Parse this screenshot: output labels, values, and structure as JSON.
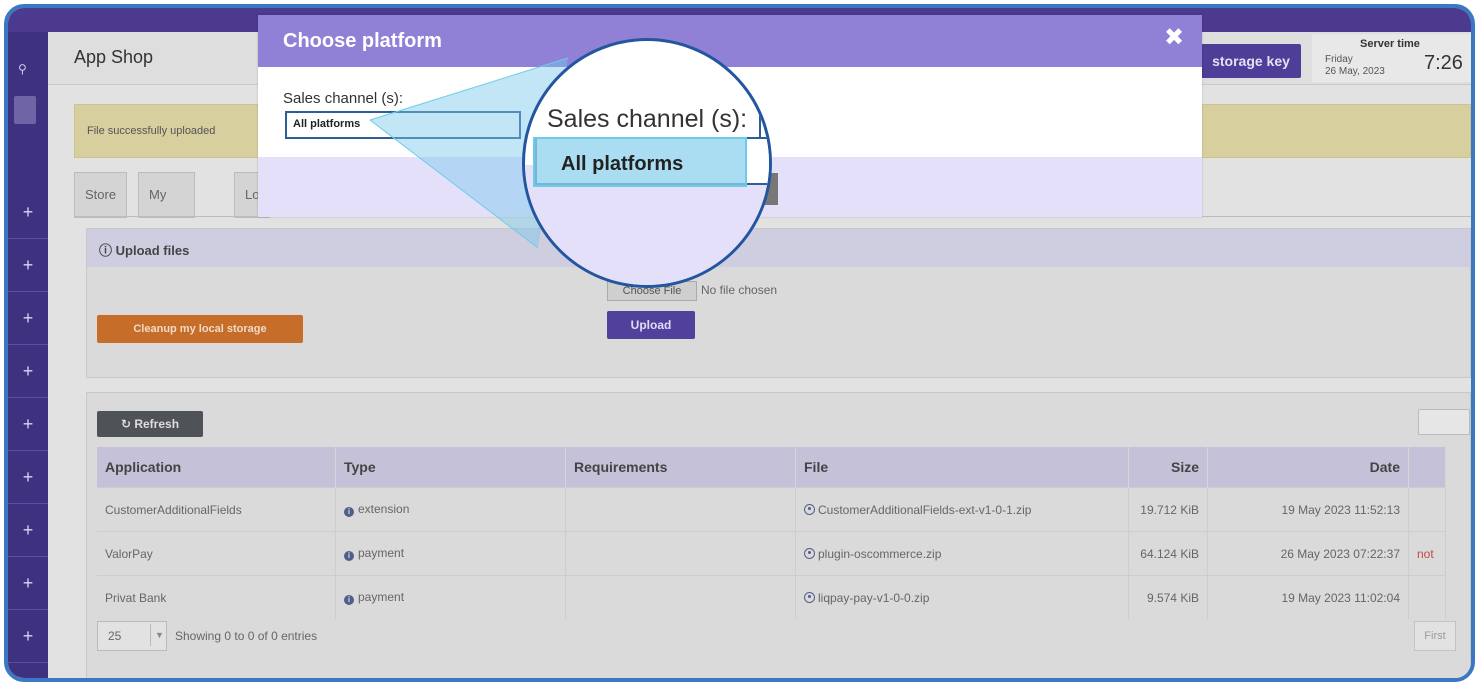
{
  "app": {
    "page_title": "App Shop",
    "storage_key_label": "storage key",
    "server": {
      "title": "Server time",
      "day": "Friday",
      "date": "26 May, 2023",
      "clock": "7:26"
    }
  },
  "alert": {
    "text": "File successfully uploaded"
  },
  "tabs": [
    "Store",
    "My library",
    "Lo"
  ],
  "upload": {
    "heading": "Upload files",
    "cleanup_label": "Cleanup my local storage",
    "choose_file_label": "Choose File",
    "no_file_text": "No file chosen",
    "upload_label": "Upload"
  },
  "list": {
    "refresh_label": "Refresh",
    "columns": [
      "Application",
      "Type",
      "Requirements",
      "File",
      "Size",
      "Date"
    ],
    "rows": [
      {
        "application": "CustomerAdditionalFields",
        "type": "extension",
        "requirements": "",
        "file": "CustomerAdditionalFields-ext-v1-0-1.zip",
        "size": "19.712 KiB",
        "date": "19 May 2023 11:52:13",
        "flag": ""
      },
      {
        "application": "ValorPay",
        "type": "payment",
        "requirements": "",
        "file": "plugin-oscommerce.zip",
        "size": "64.124 KiB",
        "date": "26 May 2023 07:22:37",
        "flag": "not"
      },
      {
        "application": "Privat Bank",
        "type": "payment",
        "requirements": "",
        "file": "liqpay-pay-v1-0-0.zip",
        "size": "9.574 KiB",
        "date": "19 May 2023 11:02:04",
        "flag": ""
      }
    ],
    "page_size": "25",
    "showing_text": "Showing 0 to 0 of 0 entries",
    "first_label": "First"
  },
  "modal": {
    "title": "Choose platform",
    "close_icon": "close-icon",
    "sales_label": "Sales channel (s):",
    "sales_value": "All platforms"
  },
  "magnifier": {
    "label": "Sales channel (s):",
    "value": "All platforms"
  },
  "colors": {
    "modal_header": "#9080d6",
    "frame_border": "#3b78c4",
    "highlight": "#8ed2ee",
    "cleanup_button": "#c66d2a",
    "primary_button": "#52419c"
  }
}
